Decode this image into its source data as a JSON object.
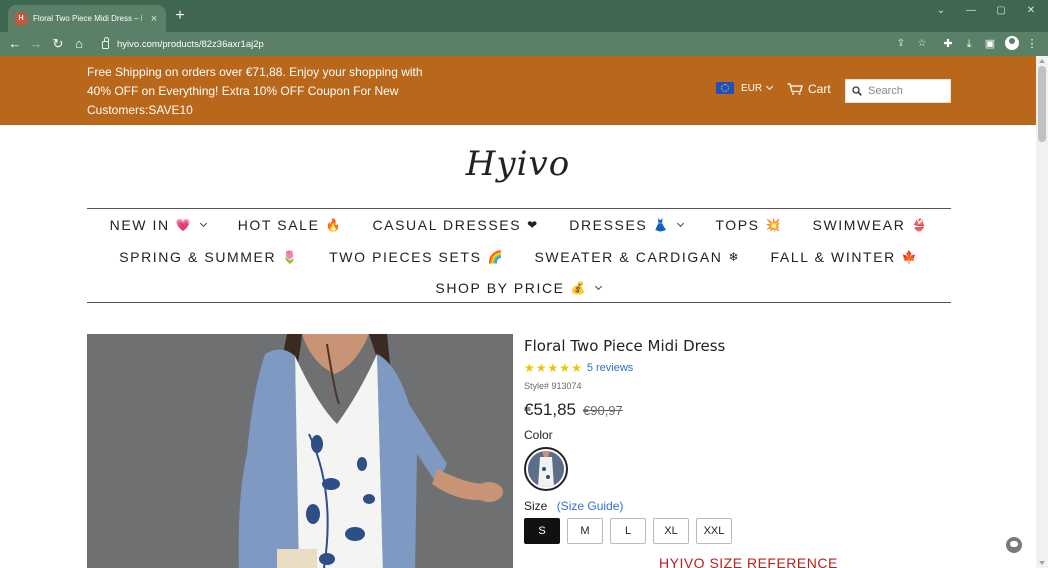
{
  "browser": {
    "tab_title": "Floral Two Piece Midi Dress – Hyivo",
    "tab_close": "×",
    "new_tab": "+",
    "url": "hyivo.com/products/82z36axr1aj2p"
  },
  "promo": {
    "text": "Free Shipping on orders over €71,88. Enjoy your shopping with 40% OFF on Everything! Extra 10% OFF Coupon For New Customers:SAVE10"
  },
  "header": {
    "currency": "EUR",
    "cart_label": "Cart",
    "search_placeholder": "Search"
  },
  "logo": "Hyivo",
  "nav": {
    "row1": [
      {
        "label": "NEW IN",
        "emoji": "💗",
        "dropdown": true
      },
      {
        "label": "HOT SALE",
        "emoji": "🔥",
        "dropdown": false
      },
      {
        "label": "CASUAL DRESSES",
        "emoji": "❤",
        "dropdown": false
      },
      {
        "label": "DRESSES",
        "emoji": "👗",
        "dropdown": true
      },
      {
        "label": "TOPS",
        "emoji": "💥",
        "dropdown": false
      },
      {
        "label": "SWIMWEAR",
        "emoji": "👙",
        "dropdown": false
      }
    ],
    "row2": [
      {
        "label": "SPRING & SUMMER",
        "emoji": "🌷",
        "dropdown": false
      },
      {
        "label": "TWO PIECES SETS",
        "emoji": "🌈",
        "dropdown": false
      },
      {
        "label": "SWEATER & CARDIGAN",
        "emoji": "❄",
        "dropdown": false
      },
      {
        "label": "FALL & WINTER",
        "emoji": "🍁",
        "dropdown": false
      }
    ],
    "row3": [
      {
        "label": "SHOP BY PRICE",
        "emoji": "💰",
        "dropdown": true
      }
    ]
  },
  "product": {
    "title": "Floral Two Piece Midi Dress",
    "rating": 5,
    "reviews": "5 reviews",
    "style": "Style# 913074",
    "price_now": "€51,85",
    "price_was": "€90,97",
    "color_label": "Color",
    "size_label": "Size",
    "size_guide": "(Size Guide)",
    "sizes": [
      "S",
      "M",
      "L",
      "XL",
      "XXL"
    ],
    "selected_size": "S",
    "size_reference": "HYIVO SIZE REFERENCE"
  },
  "colors": {
    "promo_bg": "#b9671b",
    "chrome_dark": "#3f6650",
    "chrome_light": "#5a8068",
    "link": "#2f6fd6",
    "star": "#f3c200",
    "size_ref": "#b42222"
  }
}
